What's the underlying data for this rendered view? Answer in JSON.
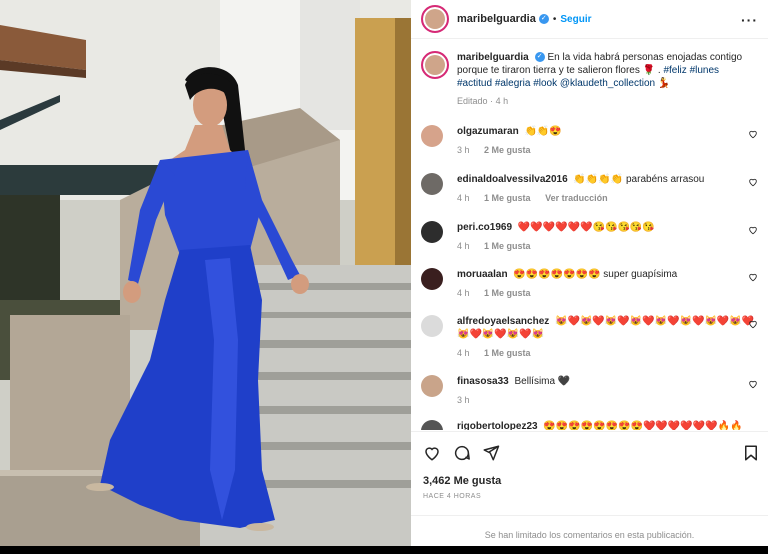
{
  "post": {
    "username": "maribelguardia",
    "follow_label": "Seguir",
    "more_icon": "more-options-icon",
    "verified_icon": "verified-badge-icon"
  },
  "caption": {
    "username": "maribelguardia",
    "text": "En la vida habrá personas enojadas contigo porque te tiraron tierra y te salieron flores 🌹 .",
    "hashtags": [
      "#feliz",
      "#lunes",
      "#actitud",
      "#alegria",
      "#look"
    ],
    "mention": "@klaudeth_collection",
    "trailing_emoji": "💃",
    "edited_label": "Editado",
    "time": "4 h"
  },
  "comments": [
    {
      "username": "olgazumaran",
      "text": "👏👏😍",
      "time": "3 h",
      "likes": "2 Me gusta",
      "translate": ""
    },
    {
      "username": "edinaldoalvessilva2016",
      "text": "👏👏👏👏 parabéns arrasou",
      "time": "4 h",
      "likes": "1 Me gusta",
      "translate": "Ver traducción"
    },
    {
      "username": "peri.co1969",
      "text": "❤️❤️❤️❤️❤️❤️😘😘😘😘😘",
      "time": "4 h",
      "likes": "1 Me gusta",
      "translate": ""
    },
    {
      "username": "moruaalan",
      "text": "😍😍😍😍😍😍😍 super guapísima",
      "time": "4 h",
      "likes": "1 Me gusta",
      "translate": ""
    },
    {
      "username": "alfredoyaelsanchez",
      "text": "😻❤️😻❤️😻❤️😻❤️😻❤️😻❤️😻❤️😻❤️😻❤️😻❤️😻❤️😻",
      "time": "4 h",
      "likes": "1 Me gusta",
      "translate": ""
    },
    {
      "username": "finasosa33",
      "text": "Bellísima 🖤",
      "time": "3 h",
      "likes": "",
      "translate": ""
    },
    {
      "username": "rigobertolopez23",
      "text": "😍😍😍😍😍😍😍😍❤️❤️❤️❤️❤️❤️🔥🔥",
      "time": "",
      "likes": "",
      "translate": ""
    }
  ],
  "actions": {
    "like_icon": "heart-icon",
    "comment_icon": "comment-icon",
    "share_icon": "share-icon",
    "save_icon": "bookmark-icon",
    "likes_count": "3,462 Me gusta",
    "time_ago": "HACE 4 HORAS"
  },
  "footer": {
    "limited_text": "Se han limitado los comentarios en esta publicación."
  },
  "colors": {
    "dress": "#1f3fc9",
    "link": "#00376b",
    "follow": "#0095f6",
    "secondary_text": "#8e8e8e"
  }
}
